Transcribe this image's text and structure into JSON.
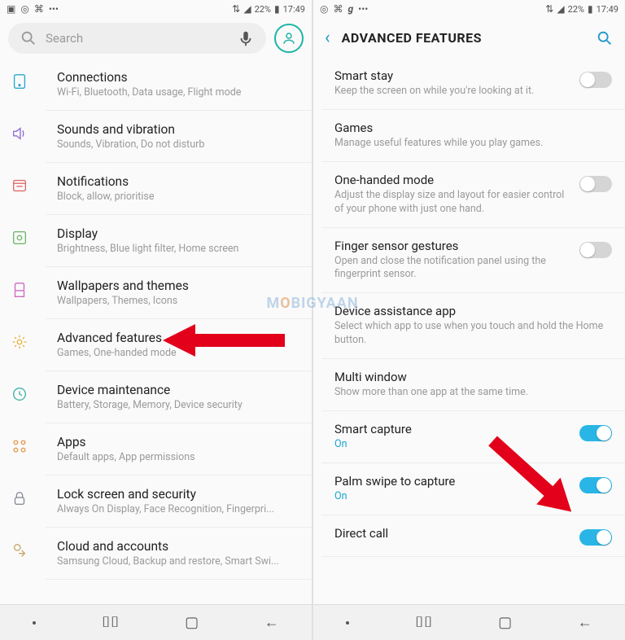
{
  "status": {
    "battery_pct": "22%",
    "time": "17:49"
  },
  "left": {
    "search_placeholder": "Search",
    "items": [
      {
        "title": "Connections",
        "sub": "Wi-Fi, Bluetooth, Data usage, Flight mode",
        "icon": "connections",
        "color": "#2aa7cf"
      },
      {
        "title": "Sounds and vibration",
        "sub": "Sounds, Vibration, Do not disturb",
        "icon": "sound",
        "color": "#8f6fd4"
      },
      {
        "title": "Notifications",
        "sub": "Block, allow, prioritise",
        "icon": "notifications",
        "color": "#e06c6c"
      },
      {
        "title": "Display",
        "sub": "Brightness, Blue light filter, Home screen",
        "icon": "display",
        "color": "#6fb96b"
      },
      {
        "title": "Wallpapers and themes",
        "sub": "Wallpapers, Themes, Icons",
        "icon": "wallpaper",
        "color": "#d06bbd"
      },
      {
        "title": "Advanced features",
        "sub": "Games, One-handed mode",
        "icon": "advanced",
        "color": "#e6b341"
      },
      {
        "title": "Device maintenance",
        "sub": "Battery, Storage, Memory, Device security",
        "icon": "maintenance",
        "color": "#3fb3a7"
      },
      {
        "title": "Apps",
        "sub": "Default apps, App permissions",
        "icon": "apps",
        "color": "#e59a4f"
      },
      {
        "title": "Lock screen and security",
        "sub": "Always On Display, Face Recognition, Fingerpri...",
        "icon": "lock",
        "color": "#8a8f9a"
      },
      {
        "title": "Cloud and accounts",
        "sub": "Samsung Cloud, Backup and restore, Smart Swi...",
        "icon": "cloud",
        "color": "#c7a96a"
      }
    ]
  },
  "right": {
    "header_title": "ADVANCED FEATURES",
    "items": [
      {
        "title": "Smart stay",
        "sub": "Keep the screen on while you're looking at it.",
        "toggle": "off"
      },
      {
        "title": "Games",
        "sub": "Manage useful features while you play games.",
        "toggle": null
      },
      {
        "title": "One-handed mode",
        "sub": "Adjust the display size and layout for easier control of your phone with just one hand.",
        "toggle": "off"
      },
      {
        "title": "Finger sensor gestures",
        "sub": "Open and close the notification panel using the fingerprint sensor.",
        "toggle": "off"
      },
      {
        "title": "Device assistance app",
        "sub": "Select which app to use when you touch and hold the Home button.",
        "toggle": null
      },
      {
        "title": "Multi window",
        "sub": "Show more than one app at the same time.",
        "toggle": null
      },
      {
        "title": "Smart capture",
        "sub": "On",
        "sub_on": true,
        "toggle": "on"
      },
      {
        "title": "Palm swipe to capture",
        "sub": "On",
        "sub_on": true,
        "toggle": "on"
      },
      {
        "title": "Direct call",
        "sub": "",
        "toggle": "on"
      }
    ]
  },
  "watermark": "M BIGYAAN"
}
